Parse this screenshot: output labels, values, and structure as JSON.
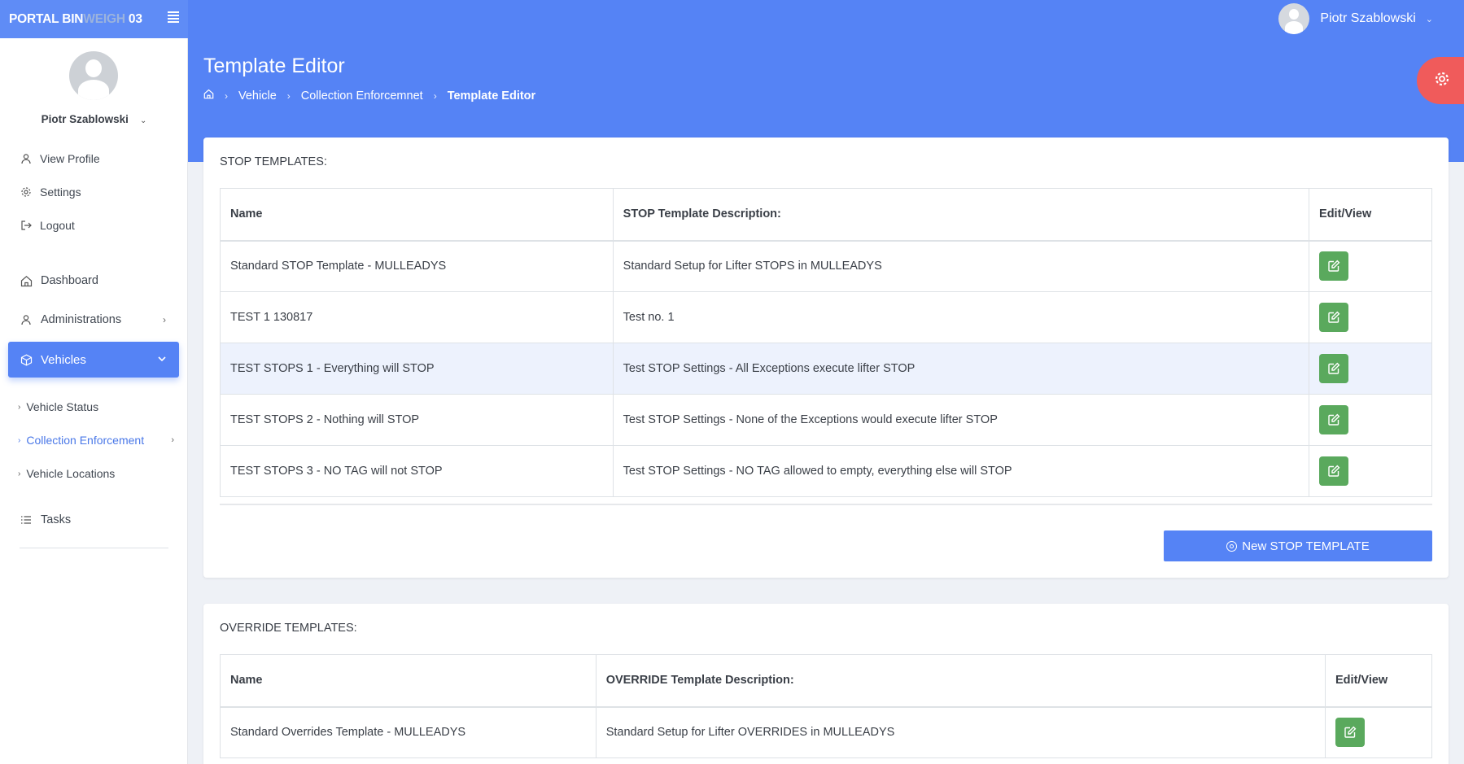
{
  "app": {
    "brand_main": "PORTAL BIN",
    "brand_weigh": "WEIGH",
    "brand_num": " 03"
  },
  "topbar": {
    "user_name": "Piotr Szablowski",
    "user_caret": "⌄"
  },
  "sidebar": {
    "user_name": "Piotr Szablowski",
    "user_caret": "⌄",
    "profile_links": [
      {
        "label": "View Profile",
        "icon": "user-icon"
      },
      {
        "label": "Settings",
        "icon": "gear-icon"
      },
      {
        "label": "Logout",
        "icon": "logout-icon"
      }
    ],
    "nav": [
      {
        "label": "Dashboard",
        "icon": "home-icon"
      },
      {
        "label": "Administrations",
        "icon": "user-icon"
      },
      {
        "label": "Vehicles",
        "icon": "cube-icon"
      }
    ],
    "vehicles_sub": [
      {
        "label": "Vehicle Status"
      },
      {
        "label": "Collection Enforcement"
      },
      {
        "label": "Vehicle Locations"
      }
    ],
    "tasks": {
      "label": "Tasks",
      "icon": "list-icon"
    }
  },
  "header": {
    "title": "Template Editor",
    "breadcrumb": [
      "Vehicle",
      "Collection Enforcemnet",
      "Template Editor"
    ]
  },
  "stop_templates": {
    "title": "STOP TEMPLATES:",
    "columns": [
      "Name",
      "STOP Template Description:",
      "Edit/View"
    ],
    "rows": [
      {
        "name": "Standard STOP Template - MULLEADYS",
        "desc": "Standard Setup for Lifter STOPS in MULLEADYS"
      },
      {
        "name": "TEST 1 130817",
        "desc": "Test no. 1"
      },
      {
        "name": "TEST STOPS 1 - Everything will STOP",
        "desc": "Test STOP Settings - All Exceptions execute lifter STOP"
      },
      {
        "name": "TEST STOPS 2 - Nothing will STOP",
        "desc": "Test STOP Settings - None of the Exceptions would execute lifter STOP"
      },
      {
        "name": "TEST STOPS 3 - NO TAG will not STOP",
        "desc": "Test STOP Settings - NO TAG allowed to empty, everything else will STOP"
      }
    ],
    "new_button": "New STOP TEMPLATE"
  },
  "override_templates": {
    "title": "OVERRIDE TEMPLATES:",
    "columns": [
      "Name",
      "OVERRIDE Template Description:",
      "Edit/View"
    ],
    "rows": [
      {
        "name": "Standard Overrides Template - MULLEADYS",
        "desc": "Standard Setup for Lifter OVERRIDES in MULLEADYS"
      }
    ]
  },
  "colors": {
    "primary": "#5583f5",
    "edit_green": "#5aa95d",
    "settings_red": "#f05b5b",
    "active_link": "#4a78e8"
  }
}
